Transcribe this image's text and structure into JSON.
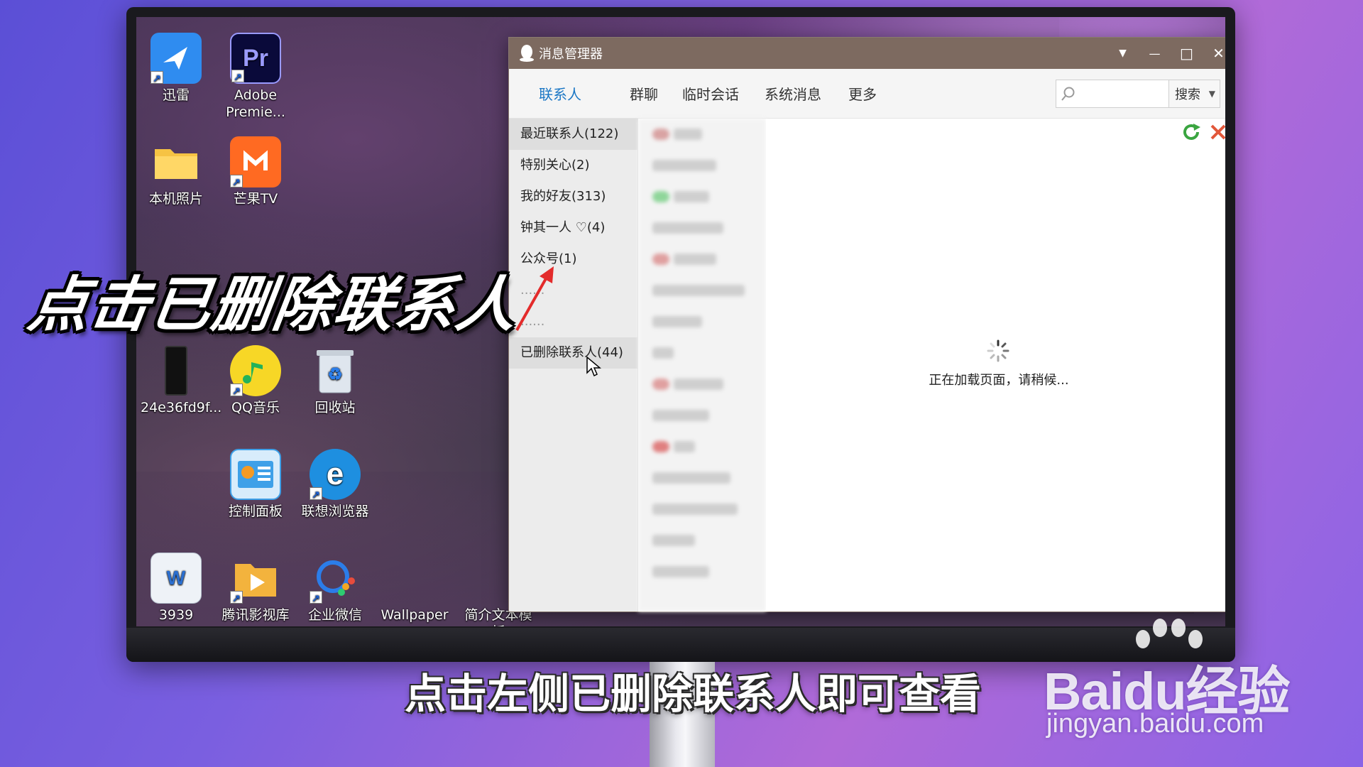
{
  "desktop": {
    "icons": [
      {
        "label": "迅雷",
        "icon": "xunlei-icon",
        "color": "#2f8cf0"
      },
      {
        "label": "Adobe\nPremie...",
        "icon": "premiere-icon",
        "glyph_text": "Pr",
        "color": "#0a0a3a"
      },
      {
        "label": "本机照片",
        "icon": "folder-icon",
        "color": "#f6c343"
      },
      {
        "label": "芒果TV",
        "icon": "mangotv-icon",
        "color": "#ff6a22"
      },
      {
        "label": "24e36fd9f...",
        "icon": "phone-file-icon",
        "color": "#111111"
      },
      {
        "label": "QQ音乐",
        "icon": "qqmusic-icon",
        "color": "#f7d726"
      },
      {
        "label": "回收站",
        "icon": "recycle-bin-icon",
        "color": "#cfd6de"
      },
      {
        "label": "控制面板",
        "icon": "control-panel-icon",
        "color": "#3ea0e8"
      },
      {
        "label": "联想浏览器",
        "icon": "lenovo-browser-icon",
        "color": "#1e8fe0"
      },
      {
        "label": "3939",
        "icon": "word-doc-icon",
        "glyph_text": "W",
        "color": "#e9eef5"
      },
      {
        "label": "腾讯影视库",
        "icon": "tencent-video-lib-icon",
        "color": "#f3b33d"
      },
      {
        "label": "企业微信",
        "icon": "wecom-icon",
        "color": "#2b7de9"
      },
      {
        "label": "Wallpaper",
        "icon": "wallpaper-icon",
        "color": "#3d5ad6"
      },
      {
        "label": "简介文本模板",
        "icon": "text-template-icon",
        "color": "#e8e8e8"
      }
    ]
  },
  "window": {
    "title": "消息管理器",
    "title_bar_color": "#7d6a60",
    "controls": {
      "dropdown": "▼",
      "minimize": "—",
      "maximize": "□",
      "close": "✕"
    },
    "tabs": [
      {
        "label": "联系人",
        "active": true
      },
      {
        "label": "群聊",
        "active": false
      },
      {
        "label": "临时会话",
        "active": false
      },
      {
        "label": "系统消息",
        "active": false
      },
      {
        "label": "更多",
        "active": false
      }
    ],
    "search": {
      "placeholder": "",
      "button_label": "搜索"
    },
    "sidebar_items": [
      {
        "label": "最近联系人(122)"
      },
      {
        "label": "特别关心(2)"
      },
      {
        "label": "我的好友(313)"
      },
      {
        "label": "钟其一人 ♡(4)"
      },
      {
        "label": "公众号(1)"
      },
      {
        "label": "......"
      },
      {
        "label": "......"
      },
      {
        "label": "已删除联系人(44)"
      }
    ],
    "loading_text": "正在加载页面，请稍候...",
    "accent_color": "#1b77c5"
  },
  "overlay": {
    "caption": "点击已删除联系人",
    "subtitle": "点击左侧已删除联系人即可查看",
    "watermark_brand": "Baidu经验",
    "watermark_url": "jingyan.baidu.com"
  }
}
